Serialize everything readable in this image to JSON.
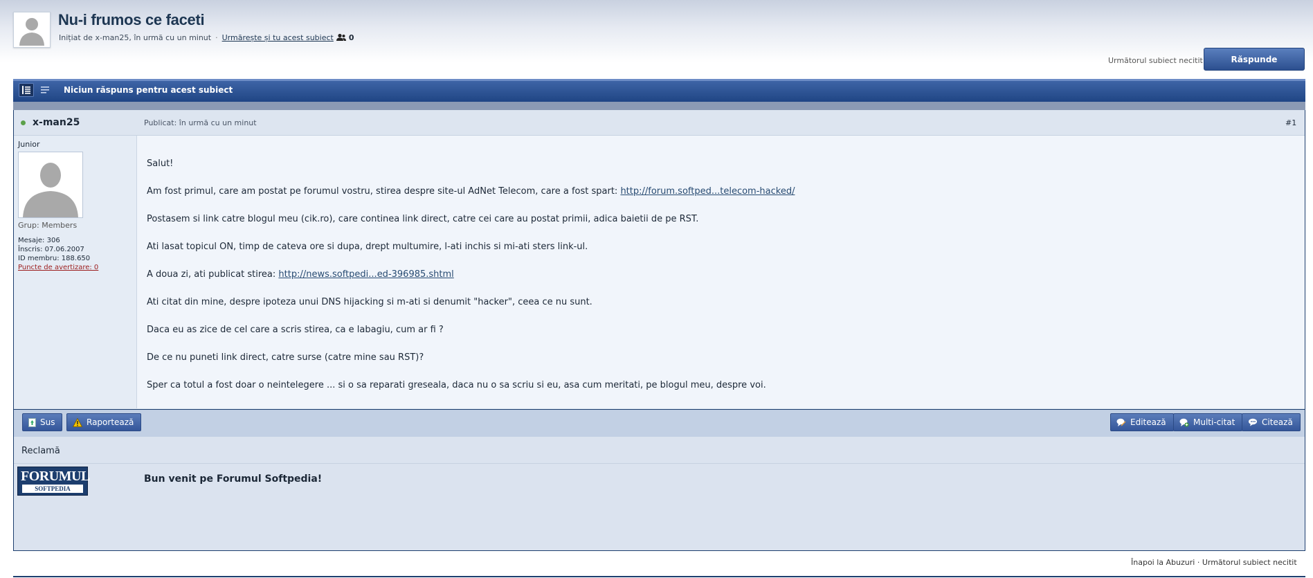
{
  "topic": {
    "title": "Nu-i frumos ce faceti",
    "started_by": "Inițiat de x-man25, în urmă cu un minut",
    "follow_link": "Urmărește și tu acest subiect",
    "followers_count": "0"
  },
  "header_actions": {
    "next_unread": "Următorul subiect necitit",
    "reply_label": "Răspunde"
  },
  "bar": {
    "title": "Niciun răspuns pentru acest subiect"
  },
  "post": {
    "author": "x-man25",
    "published": "Publicat: în urmă cu un minut",
    "number": "#1",
    "rank": "Junior",
    "group": "Grup: Members",
    "posts": "Mesaje: 306",
    "joined": "Înscris: 07.06.2007",
    "member_id": "ID membru: 188.650",
    "warn_points": "Puncte de avertizare: 0",
    "body": {
      "p1": "Salut!",
      "p2_text": "Am fost primul, care am postat pe forumul vostru, stirea despre site-ul AdNet Telecom, care a fost spart: ",
      "p2_link": "http://forum.softped...telecom-hacked/",
      "p3": "Postasem si link catre blogul meu (cik.ro), care continea link direct, catre cei care au postat primii, adica baietii de pe RST.",
      "p4": "Ati lasat topicul ON, timp de cateva ore si dupa, drept multumire, l-ati inchis si mi-ati sters link-ul.",
      "p5_text": "A doua zi, ati publicat stirea: ",
      "p5_link": "http://news.softpedi...ed-396985.shtml",
      "p6": "Ati citat din mine, despre ipoteza unui DNS hijacking si m-ati si denumit \"hacker\", ceea ce nu sunt.",
      "p7": "Daca eu as zice de cel care a scris stirea, ca e labagiu, cum ar fi ?",
      "p8": "De ce nu puneti link direct, catre surse (catre mine sau RST)?",
      "p9": "Sper ca totul a fost doar o neintelegere ... si o sa reparati greseala, daca nu o sa scriu si eu, asa cum meritati, pe blogul meu, despre voi."
    }
  },
  "controls": {
    "top": "Sus",
    "report": "Raportează",
    "edit": "Editează",
    "multiquote": "Multi-citat",
    "quote": "Citează"
  },
  "ad": {
    "label": "Reclamă",
    "logo_line1": "FORUMUL",
    "logo_line2": "SOFTPEDIA",
    "welcome": "Bun venit pe Forumul Softpedia!"
  },
  "footer": {
    "back": "Înapoi la Abuzuri",
    "sep": " · ",
    "next": "Următorul subiect necitit"
  },
  "colors": {
    "accent": "#2c4f8f",
    "bar": "#1f4584",
    "online": "#5ca14a"
  }
}
